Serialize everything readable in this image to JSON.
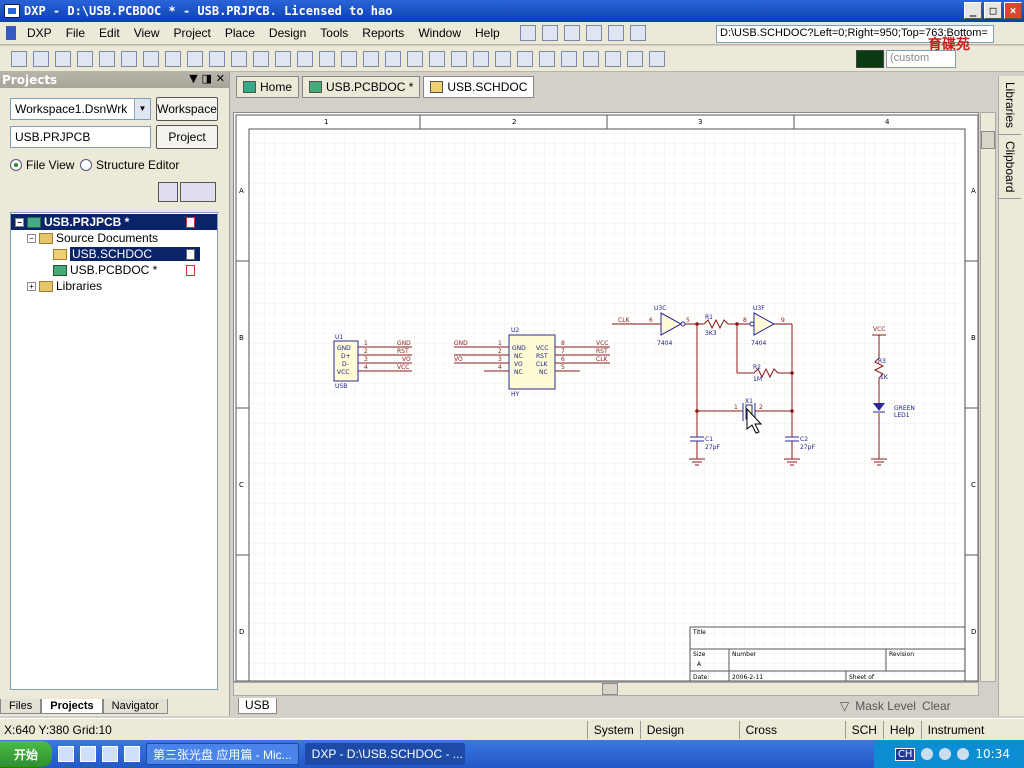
{
  "window": {
    "title": "DXP - D:\\USB.PCBDOC * - USB.PRJPCB. Licensed to hao"
  },
  "menu": [
    "DXP",
    "File",
    "Edit",
    "View",
    "Project",
    "Place",
    "Design",
    "Tools",
    "Reports",
    "Window",
    "Help"
  ],
  "toolbar": {
    "path": "D:\\USB.SCHDOC?Left=0;Right=950;Top=763;Bottom=",
    "custom": "(custom"
  },
  "logo": "育碟苑",
  "projects": {
    "title": "Projects",
    "workspace_value": "Workspace1.DsnWrk",
    "workspace_btn": "Workspace",
    "project_value": "USB.PRJPCB",
    "project_btn": "Project",
    "file_view": "File View",
    "structure_editor": "Structure Editor",
    "tree": {
      "root": "USB.PRJPCB *",
      "folder": "Source Documents",
      "sch": "USB.SCHDOC",
      "pcb": "USB.PCBDOC *",
      "libs": "Libraries"
    },
    "tabs": [
      "Files",
      "Projects",
      "Navigator"
    ]
  },
  "doctabs": [
    "Home",
    "USB.PCBDOC *",
    "USB.SCHDOC"
  ],
  "sheet": {
    "cols": [
      "1",
      "2",
      "3",
      "4"
    ],
    "rows": [
      "A",
      "B",
      "C",
      "D"
    ],
    "title": {
      "title": "Title",
      "size": "Size",
      "size_val": "A",
      "number": "Number",
      "revision": "Revision",
      "date": "Date:",
      "date_val": "2006-2-11",
      "sheet": "Sheet  of"
    }
  },
  "schematic": {
    "u1": "U1",
    "u1_label": "USB",
    "u1_pins": [
      "GND",
      "D+",
      "D-",
      "VCC"
    ],
    "u1_nets": [
      "GND",
      "RST",
      "VO",
      "VCC"
    ],
    "u2": "U2",
    "u2_label": "HY",
    "u2_left_pins": [
      "GND",
      "NC",
      "VO",
      "NC"
    ],
    "u2_right_pins": [
      "VCC",
      "RST",
      "CLK",
      "NC"
    ],
    "u2_left_nets": [
      "GND",
      "VO"
    ],
    "u2_right_nets": [
      "VCC",
      "RST",
      "CLK"
    ],
    "u3c": "U3C",
    "u3f": "U3F",
    "ic": "7404",
    "r1": "R1",
    "r1_val": "3K3",
    "r2": "R2",
    "r2_val": "1M",
    "clk": "CLK",
    "x1": "X1",
    "c1": "C1",
    "c1_val": "27pF",
    "c2": "C2",
    "c2_val": "27pF",
    "vcc": "VCC",
    "r3": "R3",
    "r3_val": "1K",
    "led": "GREEN",
    "led2": "LED1"
  },
  "sheettab": "USB",
  "mask": {
    "label": "Mask Level",
    "clear": "Clear"
  },
  "right_tabs": [
    "Libraries",
    "Clipboard"
  ],
  "status": {
    "coords": "X:640 Y:380   Grid:10",
    "buttons": [
      "System",
      "Design Compiler",
      "Cross References",
      "SCH",
      "Help",
      "Instrument Racks"
    ]
  },
  "taskbar": {
    "start": "开始",
    "tasks": [
      "第三张光盘 应用篇 - Mic...",
      "DXP - D:\\USB.SCHDOC - ..."
    ],
    "lang": "CH",
    "time": "10:34"
  }
}
